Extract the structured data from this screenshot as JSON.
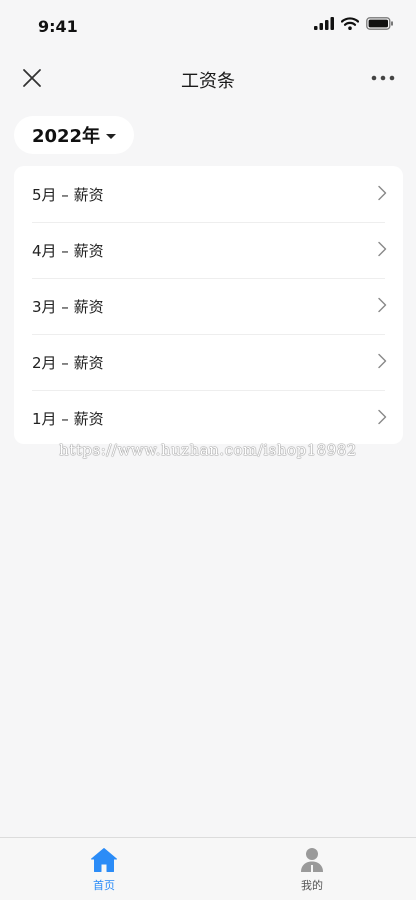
{
  "status_bar": {
    "time": "9:41"
  },
  "nav": {
    "title": "工资条"
  },
  "year_selector": {
    "label": "2022年"
  },
  "salary_list": [
    {
      "label": "5月 – 薪资"
    },
    {
      "label": "4月 – 薪资"
    },
    {
      "label": "3月 – 薪资"
    },
    {
      "label": "2月 – 薪资"
    },
    {
      "label": "1月 – 薪资"
    }
  ],
  "watermark": "https://www.huzhan.com/ishop18982",
  "tab_bar": {
    "items": [
      {
        "label": "首页",
        "icon": "home-icon",
        "active": true
      },
      {
        "label": "我的",
        "icon": "user-icon",
        "active": false
      }
    ]
  },
  "colors": {
    "accent": "#2b8cf7",
    "background": "#f6f6f7",
    "card": "#ffffff"
  }
}
